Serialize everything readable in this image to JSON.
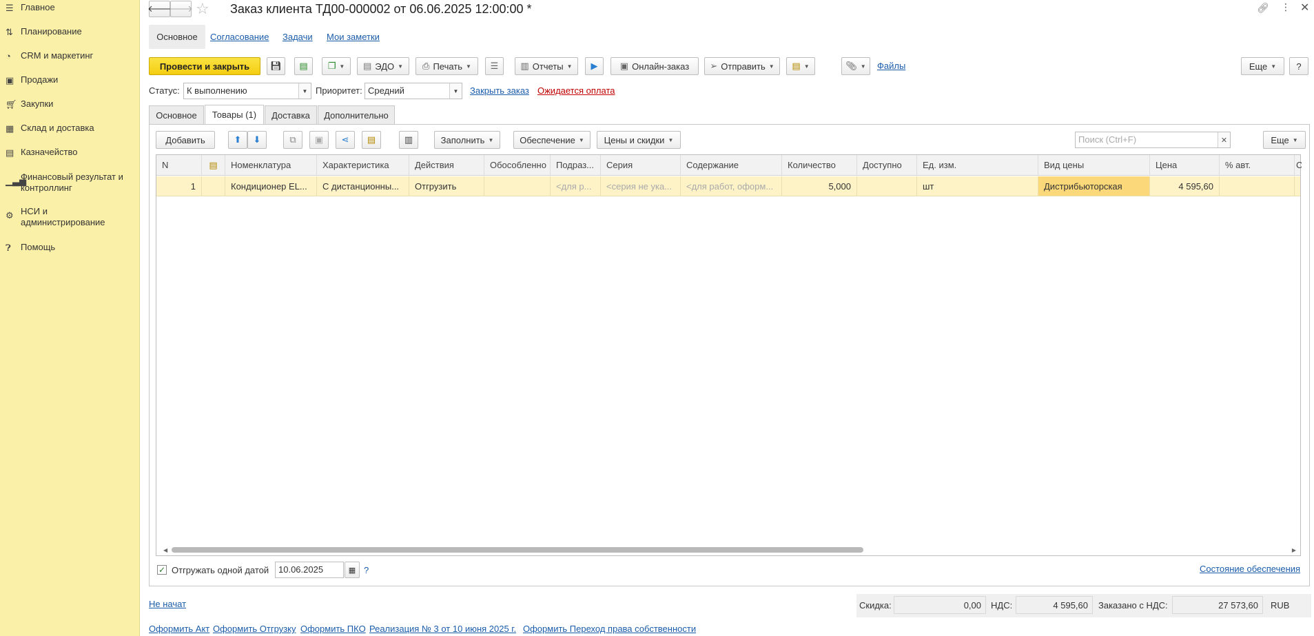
{
  "sidebar": {
    "items": [
      {
        "icon": "menu-icon",
        "label": "Главное"
      },
      {
        "icon": "planning-icon",
        "label": "Планирование"
      },
      {
        "icon": "crm-icon",
        "label": "CRM и маркетинг"
      },
      {
        "icon": "sales-icon",
        "label": "Продажи"
      },
      {
        "icon": "cart-icon",
        "label": "Закупки"
      },
      {
        "icon": "warehouse-icon",
        "label": "Склад и доставка"
      },
      {
        "icon": "treasury-icon",
        "label": "Казначейство"
      },
      {
        "icon": "finance-icon",
        "label": "Финансовый результат и контроллинг"
      },
      {
        "icon": "gear-icon",
        "label": "НСИ и администрирование"
      },
      {
        "icon": "help-icon",
        "label": "Помощь"
      }
    ]
  },
  "header": {
    "title": "Заказ клиента ТД00-000002 от 06.06.2025 12:00:00 *"
  },
  "nav_tabs": {
    "main": "Основное",
    "approval": "Согласование",
    "tasks": "Задачи",
    "notes": "Мои заметки"
  },
  "toolbar": {
    "post_close": "Провести и закрыть",
    "edo": "ЭДО",
    "print": "Печать",
    "reports": "Отчеты",
    "online_order": "Онлайн-заказ",
    "send": "Отправить",
    "files": "Файлы",
    "more": "Еще",
    "help": "?"
  },
  "status_bar": {
    "status_label": "Статус:",
    "status_value": "К выполнению",
    "priority_label": "Приоритет:",
    "priority_value": "Средний",
    "close_order": "Закрыть заказ",
    "awaiting_payment": "Ожидается оплата"
  },
  "doc_tabs": {
    "main": "Основное",
    "goods": "Товары (1)",
    "delivery": "Доставка",
    "extra": "Дополнительно"
  },
  "grid_toolbar": {
    "add": "Добавить",
    "fill": "Заполнить",
    "supply": "Обеспечение",
    "prices": "Цены и скидки",
    "search_placeholder": "Поиск (Ctrl+F)",
    "more": "Еще"
  },
  "table": {
    "columns": [
      "N",
      "",
      "Номенклатура",
      "Характеристика",
      "Действия",
      "Обособленно",
      "Подраз...",
      "Серия",
      "Содержание",
      "Количество",
      "Доступно",
      "Ед. изм.",
      "Вид цены",
      "Цена",
      "% авт.",
      "С"
    ],
    "rows": [
      [
        "1",
        "",
        "Кондиционер EL...",
        "С дистанционны...",
        "Отгрузить",
        "",
        "<для р...",
        "<серия не ука...",
        "<для работ, оформ...",
        "5,000",
        "",
        "шт",
        "Дистрибьюторская",
        "4 595,60",
        "",
        ""
      ]
    ]
  },
  "shipping": {
    "one_date_label": "Отгружать одной датой",
    "date_value": "10.06.2025",
    "help": "?",
    "supply_state": "Состояние обеспечения"
  },
  "footer": {
    "not_started": "Не начат",
    "discount_label": "Скидка:",
    "discount_value": "0,00",
    "vat_label": "НДС:",
    "vat_value": "4 595,60",
    "ordered_label": "Заказано с НДС:",
    "ordered_value": "27 573,60",
    "currency": "RUB"
  },
  "bottom_links": {
    "act": "Оформить Акт",
    "shipment": "Оформить Отгрузку",
    "pko": "Оформить ПКО",
    "realization": "Реализация № 3 от 10 июня 2025 г.",
    "ownership": "Оформить Переход права собственности"
  }
}
